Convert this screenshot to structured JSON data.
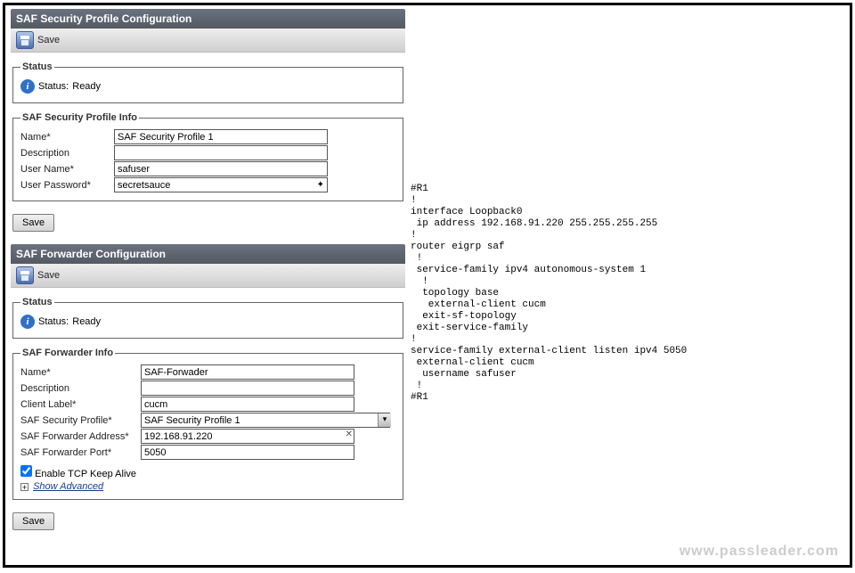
{
  "section1": {
    "title": "SAF Security Profile Configuration",
    "toolbar_save": "Save",
    "status_label": "Status:",
    "status_value": "Ready",
    "fieldset_title": "Status",
    "info_fieldset": "SAF Security Profile Info",
    "labels": {
      "name": "Name",
      "description": "Description",
      "username": "User Name",
      "password": "User Password"
    },
    "values": {
      "name": "SAF Security Profile 1",
      "description": "",
      "username": "safuser",
      "password": "secretsauce"
    },
    "save_btn": "Save"
  },
  "section2": {
    "title": "SAF Forwarder Configuration",
    "toolbar_save": "Save",
    "status_label": "Status:",
    "status_value": "Ready",
    "fieldset_title": "Status",
    "info_fieldset": "SAF Forwarder Info",
    "labels": {
      "name": "Name",
      "description": "Description",
      "client_label": "Client Label",
      "sec_profile": "SAF Security Profile",
      "fwd_addr": "SAF Forwarder Address",
      "fwd_port": "SAF Forwarder Port"
    },
    "values": {
      "name": "SAF-Forwader",
      "description": "",
      "client_label": "cucm",
      "sec_profile": "SAF Security Profile 1",
      "fwd_addr": "192.168.91.220",
      "fwd_port": "5050"
    },
    "keepalive": "Enable TCP Keep Alive",
    "show_adv": "Show Advanced",
    "save_btn": "Save"
  },
  "config_text": "#R1\n!\ninterface Loopback0\n ip address 192.168.91.220 255.255.255.255\n!\nrouter eigrp saf\n !\n service-family ipv4 autonomous-system 1\n  !\n  topology base\n   external-client cucm\n  exit-sf-topology\n exit-service-family\n!\nservice-family external-client listen ipv4 5050\n external-client cucm\n  username safuser\n !\n#R1",
  "watermark": "www.passleader.com"
}
